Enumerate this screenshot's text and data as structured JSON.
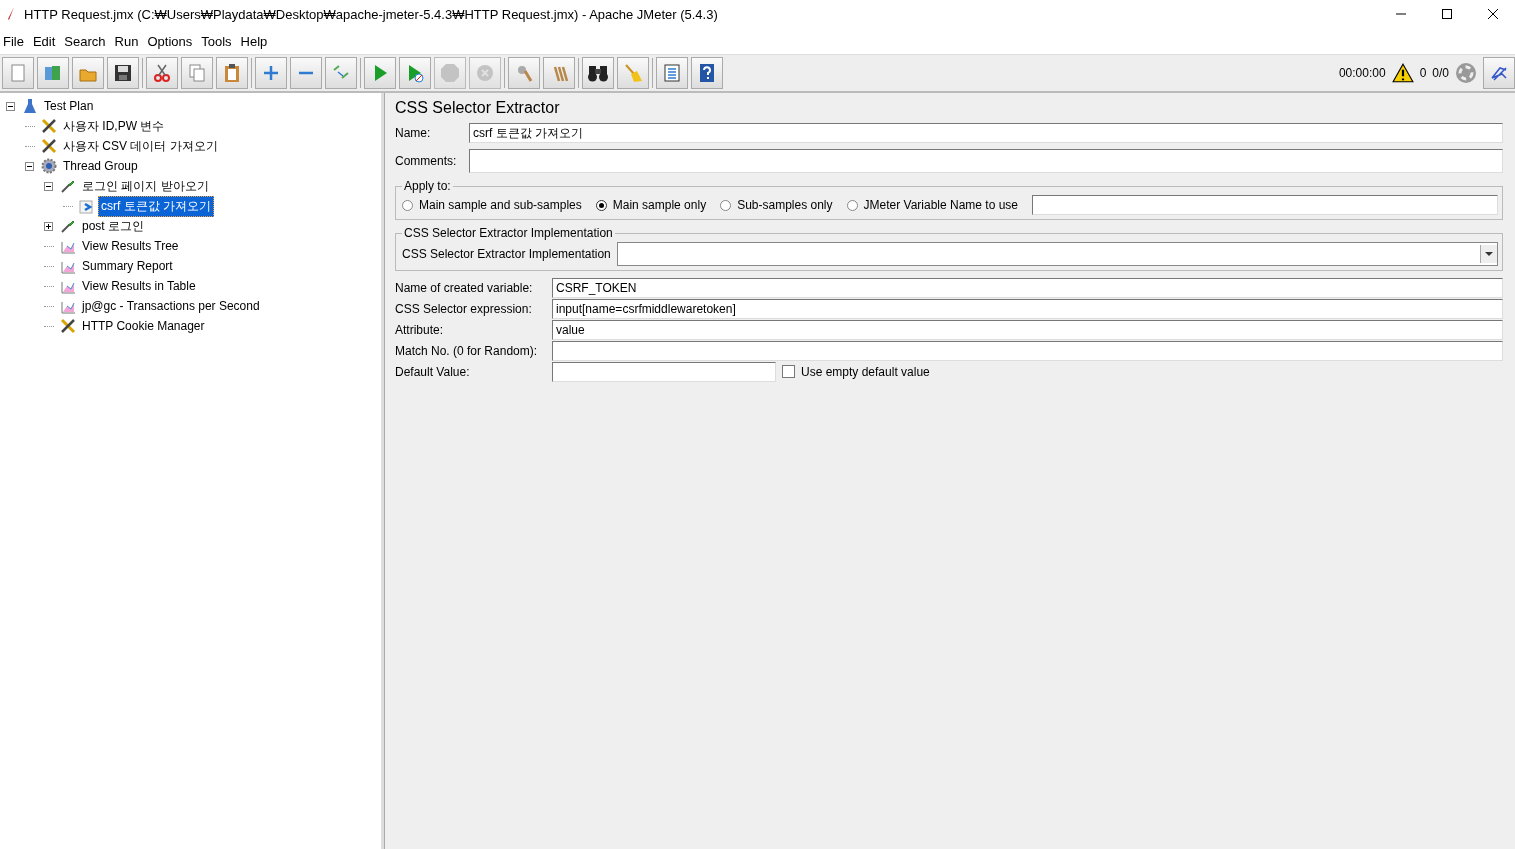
{
  "window": {
    "title": "HTTP Request.jmx (C:₩Users₩Playdata₩Desktop₩apache-jmeter-5.4.3₩HTTP Request.jmx) - Apache JMeter (5.4.3)"
  },
  "menu": [
    "File",
    "Edit",
    "Search",
    "Run",
    "Options",
    "Tools",
    "Help"
  ],
  "toolbar": [
    {
      "buttons": [
        {
          "kind": "new",
          "disabled": false
        },
        {
          "kind": "templates",
          "disabled": false
        },
        {
          "kind": "open",
          "disabled": false
        },
        {
          "kind": "save",
          "disabled": false
        }
      ]
    },
    {
      "buttons": [
        {
          "kind": "cut",
          "disabled": false
        },
        {
          "kind": "copy",
          "disabled": false
        },
        {
          "kind": "paste",
          "disabled": false
        }
      ]
    },
    {
      "buttons": [
        {
          "kind": "expand",
          "disabled": false
        },
        {
          "kind": "collapse",
          "disabled": false
        },
        {
          "kind": "toggle",
          "disabled": false
        }
      ]
    },
    {
      "buttons": [
        {
          "kind": "start",
          "disabled": false
        },
        {
          "kind": "start-no-timers",
          "disabled": false
        },
        {
          "kind": "stop",
          "disabled": true
        },
        {
          "kind": "shutdown",
          "disabled": true
        }
      ]
    },
    {
      "buttons": [
        {
          "kind": "clear",
          "disabled": false
        },
        {
          "kind": "clear-all",
          "disabled": false
        }
      ]
    },
    {
      "buttons": [
        {
          "kind": "search",
          "disabled": false
        },
        {
          "kind": "reset-search",
          "disabled": false
        }
      ]
    },
    {
      "buttons": [
        {
          "kind": "function-helper",
          "disabled": false
        },
        {
          "kind": "help",
          "disabled": false
        }
      ]
    }
  ],
  "status": {
    "elapsed": "00:00:00",
    "warnings": "0",
    "threads": "0/0"
  },
  "tree": [
    {
      "label": "Test Plan",
      "kind": "test-plan",
      "expanded": true,
      "selected": false,
      "children": [
        {
          "label": "사용자 ID,PW 변수",
          "kind": "config",
          "selected": false
        },
        {
          "label": "사용자 CSV 데이터 가져오기",
          "kind": "config",
          "selected": false
        },
        {
          "label": "Thread Group",
          "kind": "thread-group",
          "expanded": true,
          "selected": false,
          "children": [
            {
              "label": "로그인 페이지 받아오기",
              "kind": "sampler",
              "expanded": true,
              "selected": false,
              "children": [
                {
                  "label": "csrf 토큰값 가져오기",
                  "kind": "extractor",
                  "selected": true
                }
              ]
            },
            {
              "label": "post 로그인",
              "kind": "sampler",
              "expanded": false,
              "selected": false
            },
            {
              "label": "View Results Tree",
              "kind": "listener",
              "selected": false
            },
            {
              "label": "Summary Report",
              "kind": "listener",
              "selected": false
            },
            {
              "label": "View Results in Table",
              "kind": "listener",
              "selected": false
            },
            {
              "label": "jp@gc - Transactions per Second",
              "kind": "listener",
              "selected": false
            },
            {
              "label": "HTTP Cookie Manager",
              "kind": "config",
              "selected": false
            }
          ]
        }
      ]
    }
  ],
  "panel": {
    "title": "CSS Selector Extractor",
    "name": {
      "label": "Name:",
      "value": "csrf 토큰값 가져오기"
    },
    "comments": {
      "label": "Comments:"
    },
    "apply_to": {
      "legend": "Apply to:",
      "options": [
        {
          "label": "Main sample and sub-samples",
          "selected": false
        },
        {
          "label": "Main sample only",
          "selected": true
        },
        {
          "label": "Sub-samples only",
          "selected": false
        },
        {
          "label": "JMeter Variable Name to use",
          "selected": false
        }
      ]
    },
    "implementation": {
      "legend": "CSS Selector Extractor Implementation",
      "label": "CSS Selector Extractor Implementation"
    },
    "fields": [
      {
        "label": "Name of created variable:",
        "value": "CSRF_TOKEN"
      },
      {
        "label": "CSS Selector expression:",
        "value": "input[name=csrfmiddlewaretoken]"
      },
      {
        "label": "Attribute:",
        "value": "value"
      },
      {
        "label": "Match No. (0 for Random):"
      }
    ],
    "default_value": {
      "label": "Default Value:"
    },
    "use_empty_default": {
      "label": "Use empty default value",
      "checked": false
    }
  }
}
